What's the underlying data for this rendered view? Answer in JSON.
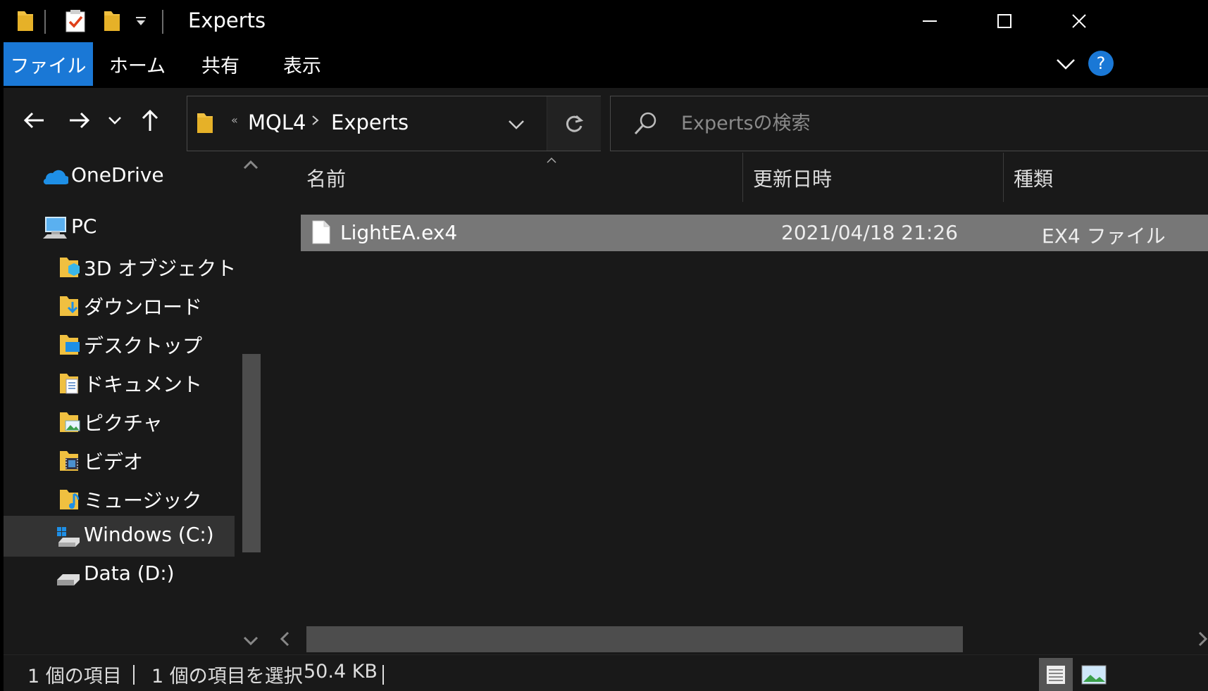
{
  "window": {
    "title": "Experts",
    "minimize_glyph": "—",
    "maximize_glyph": "☐",
    "close_glyph": "✕"
  },
  "ribbon": {
    "tabs": [
      {
        "label": "ファイル",
        "active": true
      },
      {
        "label": "ホーム",
        "active": false
      },
      {
        "label": "共有",
        "active": false
      },
      {
        "label": "表示",
        "active": false
      }
    ],
    "help_glyph": "?"
  },
  "address": {
    "overflow_glyph": "«",
    "crumbs": [
      "MQL4",
      "Experts"
    ]
  },
  "search": {
    "placeholder": "Expertsの検索"
  },
  "sidebar": {
    "items": [
      {
        "label": "OneDrive",
        "icon": "onedrive-icon"
      },
      {
        "label": "PC",
        "icon": "pc-icon"
      },
      {
        "label": "3D オブジェクト",
        "icon": "3d-objects-folder-icon"
      },
      {
        "label": "ダウンロード",
        "icon": "downloads-folder-icon"
      },
      {
        "label": "デスクトップ",
        "icon": "desktop-folder-icon"
      },
      {
        "label": "ドキュメント",
        "icon": "documents-folder-icon"
      },
      {
        "label": "ピクチャ",
        "icon": "pictures-folder-icon"
      },
      {
        "label": "ビデオ",
        "icon": "videos-folder-icon"
      },
      {
        "label": "ミュージック",
        "icon": "music-folder-icon"
      },
      {
        "label": "Windows (C:)",
        "icon": "windows-drive-icon",
        "selected": true
      },
      {
        "label": "Data (D:)",
        "icon": "drive-icon"
      }
    ]
  },
  "filelist": {
    "columns": [
      "名前",
      "更新日時",
      "種類"
    ],
    "files": [
      {
        "name": "LightEA.ex4",
        "modified": "2021/04/18 21:26",
        "type": "EX4 ファイル"
      }
    ]
  },
  "status": {
    "item_count": "1 個の項目",
    "selection": "1 個の項目を選択",
    "size": "50.4 KB"
  },
  "colors": {
    "accent": "#1a78d6",
    "selected_row": "#777777",
    "background": "#191919"
  }
}
